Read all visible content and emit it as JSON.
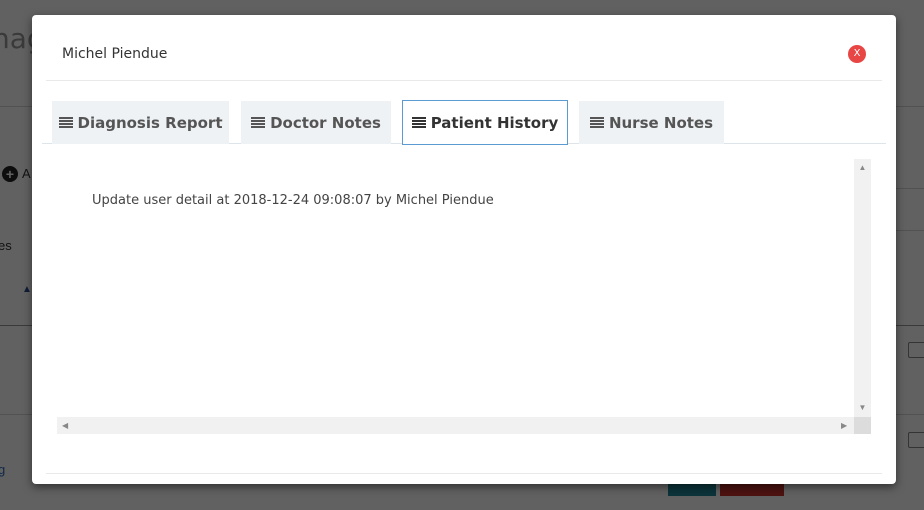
{
  "background": {
    "page_title_fragment": "nag",
    "fragment_es": "es",
    "fragment_a": "A",
    "fragment_g": "g"
  },
  "modal": {
    "title": "Michel Piendue",
    "close_label": "X",
    "tabs": [
      {
        "label": "Diagnosis Report",
        "icon": "list-icon",
        "active": false
      },
      {
        "label": "Doctor Notes",
        "icon": "list-icon",
        "active": false
      },
      {
        "label": "Patient History",
        "icon": "list-icon",
        "active": true
      },
      {
        "label": "Nurse Notes",
        "icon": "list-icon",
        "active": false
      }
    ],
    "history_entry": "Update user detail at 2018-12-24 09:08:07 by Michel Piendue"
  },
  "colors": {
    "close_button": "#e84545",
    "active_tab_border": "#5b9bd1",
    "tab_background": "#eef2f5"
  }
}
